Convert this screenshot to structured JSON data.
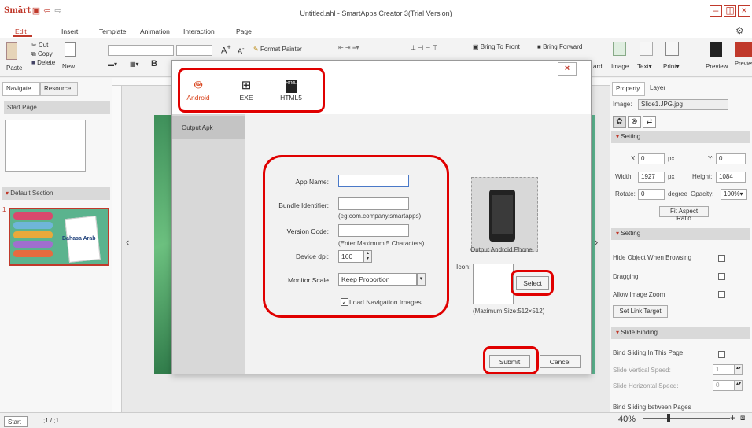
{
  "titlebar": {
    "logo": "Smārt",
    "title": "Untitled.ahl - SmartApps Creator 3(Trial Version)"
  },
  "menu": [
    "Edit",
    "Insert",
    "Template",
    "Animation",
    "Interaction",
    "Page"
  ],
  "ribbon": {
    "paste": "Paste",
    "cut": "Cut",
    "copy": "Copy",
    "delete": "Delete",
    "new": "New",
    "format_painter": "Format Painter",
    "bring_to_front": "Bring To Front",
    "bring_forward": "Bring Forward",
    "image": "Image",
    "text": "Text",
    "print": "Print",
    "preview": "Preview",
    "preview_begin": "Preview Begin",
    "bold": "B",
    "ard_fragment": "ard"
  },
  "left": {
    "tabs": [
      "Navigate",
      "Resource"
    ],
    "start_page": "Start Page",
    "default_section": "Default Section",
    "slide_number": "1",
    "thumb_title": "Bahasa Arab"
  },
  "right": {
    "tabs": [
      "Property",
      "Layer"
    ],
    "image_label": "Image:",
    "image_value": "Slide1.JPG.jpg",
    "section_setting": "Setting",
    "x_label": "X:",
    "x_value": "0",
    "y_label": "Y:",
    "y_value": "0",
    "px1": "px",
    "px2": "px",
    "width_label": "Width:",
    "width_value": "1927",
    "height_label": "Height:",
    "height_value": "1084",
    "rotate_label": "Rotate:",
    "rotate_value": "0",
    "degree_label": "degree",
    "opacity_label": "Opacity:",
    "opacity_value": "100%",
    "fit_aspect": "Fit Aspect Ratio",
    "section_setting2": "Setting",
    "hide_object": "Hide Object When Browsing",
    "dragging": "Dragging",
    "allow_zoom": "Allow Image Zoom",
    "set_link": "Set Link Target",
    "section_slide_binding": "Slide Binding",
    "bind_sliding": "Bind Sliding In This Page",
    "slide_vertical": "Slide Vertical Speed:",
    "slide_vertical_value": "1",
    "slide_horizontal": "Slide Horizontal Speed:",
    "slide_horizontal_value": "0",
    "bind_between": "Bind Sliding between Pages"
  },
  "status": {
    "start_tab": "Start",
    "coords": ";1 / ;1",
    "zoom": "40%"
  },
  "dialog": {
    "platforms": [
      "Android",
      "EXE",
      "HTML5"
    ],
    "html5_badge": "HTML",
    "side_item": "Output Apk",
    "app_name_label": "App Name:",
    "app_name_value": "",
    "bundle_label": "Bundle Identifier:",
    "bundle_value": "",
    "bundle_hint": "(eg:com.company.smartapps)",
    "version_label": "Version Code:",
    "version_value": "",
    "version_hint": "(Enter Maximum 5 Characters)",
    "dpi_label": "Device dpi:",
    "dpi_value": "160",
    "monitor_label": "Monitor Scale",
    "monitor_value": "Keep Proportion",
    "load_nav": "Load Navigation Images",
    "phone_caption": "Output Android Phone",
    "icon_label": "Icon:",
    "select_btn": "Select",
    "max_size": "(Maximum Size:512×512)",
    "submit_btn": "Submit",
    "cancel_btn": "Cancel",
    "close": "×"
  },
  "colors": {
    "accent": "#c0392b",
    "highlight": "#e00000",
    "android": "#d9451e",
    "selection": "#c0392b"
  }
}
